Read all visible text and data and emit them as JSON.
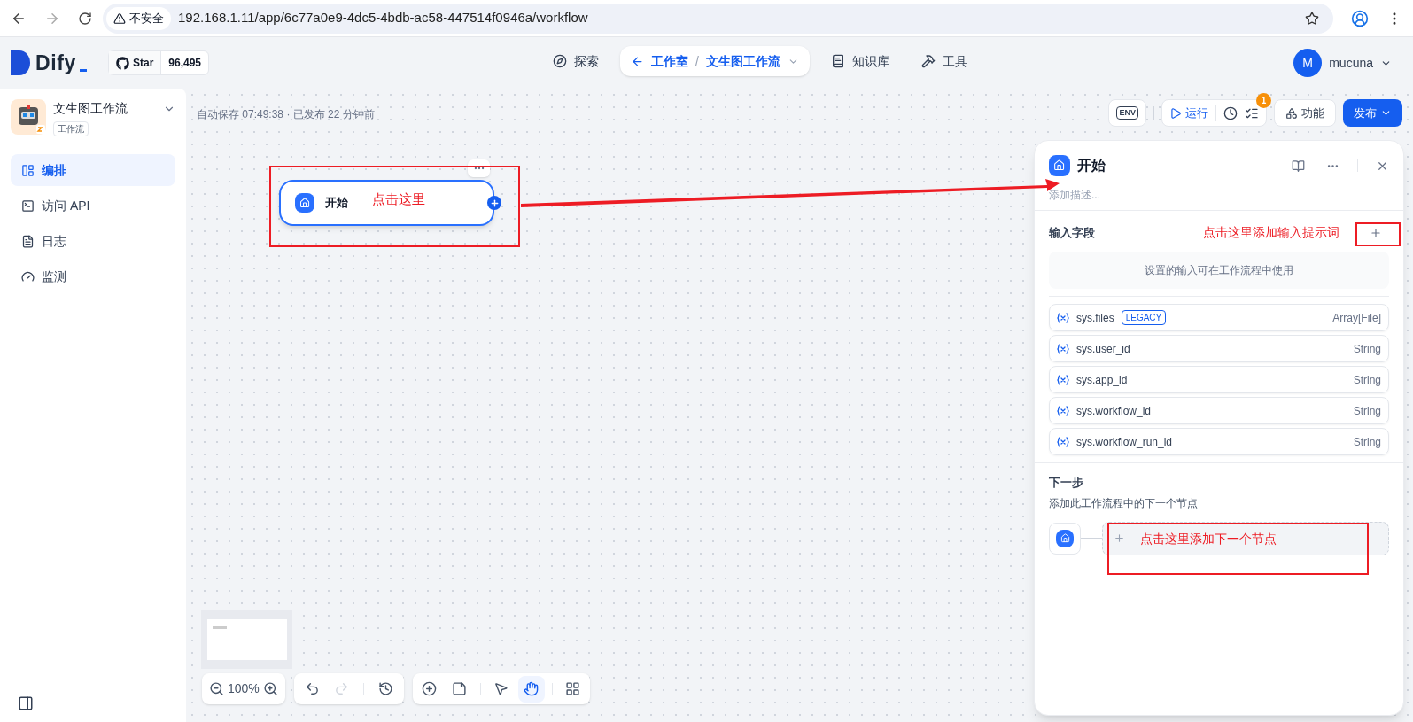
{
  "browser": {
    "security": "不安全",
    "url": "192.168.1.11/app/6c77a0e9-4dc5-4bdb-ac58-447514f0946a/workflow"
  },
  "header": {
    "logo": "Dify",
    "github": {
      "label": "Star",
      "count": "96,495"
    },
    "nav": [
      {
        "kind": "explore",
        "label": "探索"
      },
      {
        "kind": "breadcrumb",
        "parent": "工作室",
        "separator": "/",
        "current": "文生图工作流"
      },
      {
        "kind": "knowledge",
        "label": "知识库"
      },
      {
        "kind": "tools",
        "label": "工具"
      }
    ],
    "user": {
      "initial": "M",
      "name": "mucuna"
    }
  },
  "app": {
    "name": "文生图工作流",
    "type": "工作流"
  },
  "sidebar": {
    "items": [
      {
        "kind": "orchestrate",
        "label": "编排",
        "selected": true
      },
      {
        "kind": "api",
        "label": "访问 API",
        "selected": false
      },
      {
        "kind": "logs",
        "label": "日志",
        "selected": false
      },
      {
        "kind": "monitor",
        "label": "监测",
        "selected": false
      }
    ]
  },
  "canvas": {
    "status": "自动保存 07:49:38 · 已发布 22 分钟前",
    "toolbar": {
      "env": "ENV",
      "run": "运行",
      "badge": "1",
      "features": "功能",
      "publish": "发布"
    },
    "node": {
      "title": "开始",
      "selected": true
    },
    "zoom": "100%",
    "history": [
      {
        "kind": "undo",
        "disabled": false
      },
      {
        "kind": "redo",
        "disabled": true
      }
    ],
    "tools": [
      {
        "kind": "add",
        "selected": false
      },
      {
        "kind": "note",
        "selected": false
      },
      {
        "kind": "pointer",
        "selected": false
      },
      {
        "kind": "hand",
        "selected": true
      },
      {
        "kind": "layout",
        "selected": false
      }
    ]
  },
  "panel": {
    "title": "开始",
    "description_placeholder": "添加描述...",
    "inputs_title": "输入字段",
    "inputs_empty": "设置的输入可在工作流程中使用",
    "variables": [
      {
        "name": "sys.files",
        "tag": "LEGACY",
        "type": "Array[File]"
      },
      {
        "name": "sys.user_id",
        "type": "String"
      },
      {
        "name": "sys.app_id",
        "type": "String"
      },
      {
        "name": "sys.workflow_id",
        "type": "String"
      },
      {
        "name": "sys.workflow_run_id",
        "type": "String"
      }
    ],
    "next_title": "下一步",
    "next_description": "添加此工作流程中的下一个节点"
  },
  "annotations": [
    {
      "text": "点击这里"
    },
    {
      "text": "点击这里添加输入提示词"
    },
    {
      "text": "点击这里添加下一个节点"
    }
  ]
}
